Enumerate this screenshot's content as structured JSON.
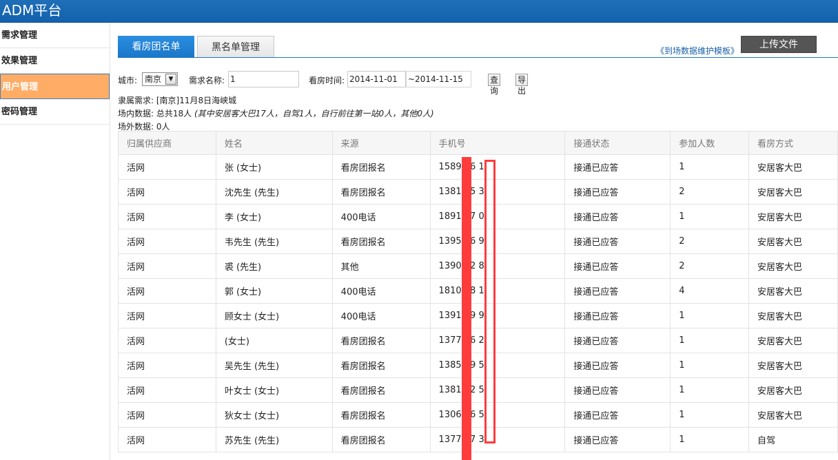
{
  "app": {
    "title": "ADM平台"
  },
  "sidebar": {
    "items": [
      {
        "label": "需求管理",
        "active": false
      },
      {
        "label": "效果管理",
        "active": false
      },
      {
        "label": "用户管理",
        "active": true
      },
      {
        "label": "密码管理",
        "active": false
      }
    ]
  },
  "tabs": [
    {
      "label": "看房团名单",
      "active": true
    },
    {
      "label": "黑名单管理",
      "active": false
    }
  ],
  "toolbar": {
    "template_link": "《到场数据维护模板》",
    "upload_label": "上传文件"
  },
  "filters": {
    "city_label": "城市:",
    "city_value": "南京",
    "demand_label": "需求名称:",
    "demand_value": "1",
    "time_label": "看房时间:",
    "time_from": "2014-11-01",
    "time_to": "~2014-11-15",
    "query_label": "查询",
    "export_label": "导出"
  },
  "info": {
    "demand": "隶属需求: [南京]11月8日海峡城",
    "inside_main": "场内数据: 总共18人",
    "inside_detail": "(其中安居客大巴17人，自驾1人，自行前往第一站0人，其他0人)",
    "outside": "场外数据: 0人"
  },
  "table": {
    "headers": [
      "归属供应商",
      "姓名",
      "来源",
      "手机号",
      "接通状态",
      "参加人数",
      "看房方式"
    ],
    "rows": [
      [
        "活网",
        "张 (女士)",
        "看房团报名",
        "1589 66 1",
        "接通已应答",
        "1",
        "安居客大巴"
      ],
      [
        "活网",
        "沈先生 (先生)",
        "看房团报名",
        "1381 05 3",
        "接通已应答",
        "2",
        "安居客大巴"
      ],
      [
        "活网",
        "李 (女士)",
        "400电话",
        "1891 87 0",
        "接通已应答",
        "1",
        "安居客大巴"
      ],
      [
        "活网",
        "韦先生 (先生)",
        "看房团报名",
        "1395 26 9",
        "接通已应答",
        "2",
        "安居客大巴"
      ],
      [
        "活网",
        "裘 (先生)",
        "其他",
        "1390 72 8",
        "接通已应答",
        "2",
        "安居客大巴"
      ],
      [
        "活网",
        "郭 (女士)",
        "400电话",
        "1810 88 1",
        "接通已应答",
        "4",
        "安居客大巴"
      ],
      [
        "活网",
        "顾女士 (女士)",
        "400电话",
        "1391 69 9",
        "接通已应答",
        "1",
        "安居客大巴"
      ],
      [
        "活网",
        "(女士)",
        "看房团报名",
        "1377 46 2",
        "接通已应答",
        "1",
        "安居客大巴"
      ],
      [
        "活网",
        "吴先生 (先生)",
        "看房团报名",
        "1385 29 5",
        "接通已应答",
        "1",
        "安居客大巴"
      ],
      [
        "活网",
        "叶女士 (女士)",
        "看房团报名",
        "1381 72 5",
        "接通已应答",
        "1",
        "安居客大巴"
      ],
      [
        "活网",
        "狄女士 (女士)",
        "看房团报名",
        "1306 66 5",
        "接通已应答",
        "1",
        "安居客大巴"
      ],
      [
        "活网",
        "苏先生 (先生)",
        "看房团报名",
        "1377 77 3",
        "接通已应答",
        "1",
        "自驾"
      ]
    ]
  }
}
